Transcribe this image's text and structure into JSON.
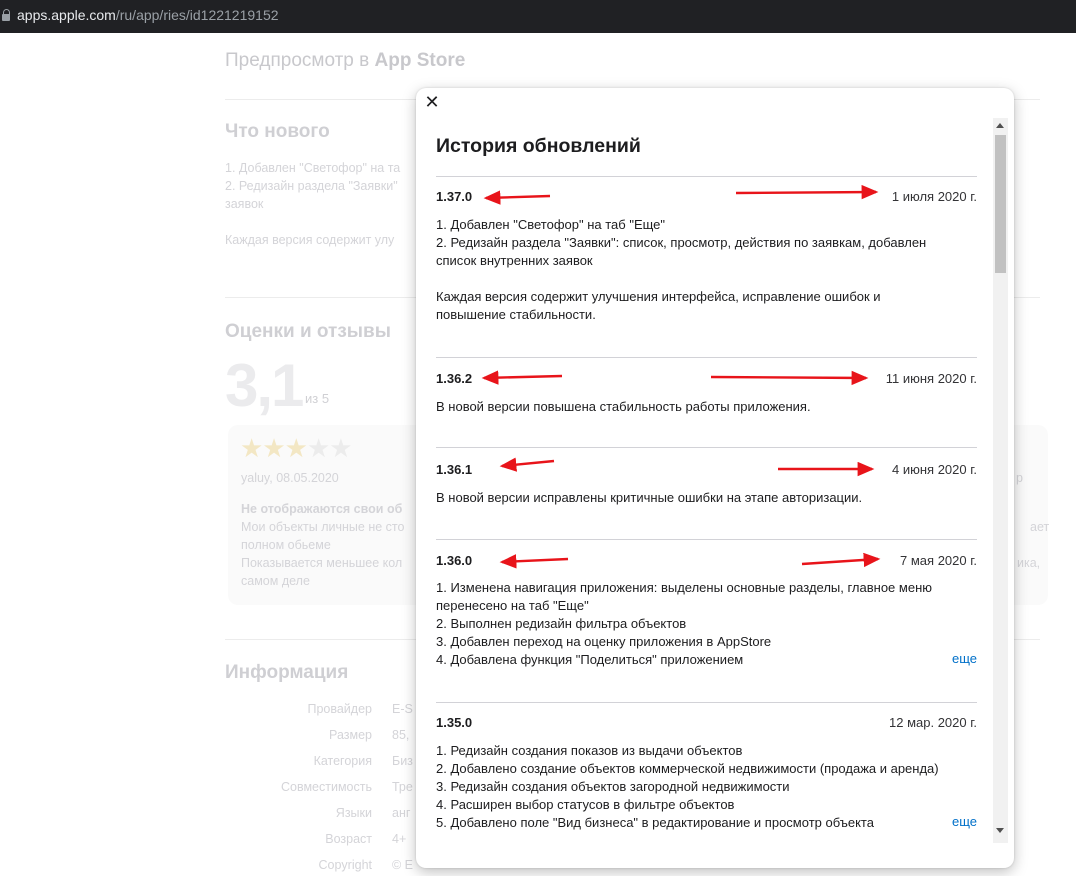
{
  "browser": {
    "url_host": "apps.apple.com",
    "url_path": "/ru/app/ries/id1221219152"
  },
  "background": {
    "preview_prefix": "Предпросмотр в ",
    "preview_store": "App Store",
    "whats_new_title": "Что нового",
    "whats_new_lines": [
      "1. Добавлен \"Светофор\" на та",
      "2. Редизайн раздела \"Заявки\"",
      "заявок",
      "Каждая версия содержит улу"
    ],
    "ratings_title": "Оценки и отзывы",
    "rating_value": "3,1",
    "rating_out_of": "из 5",
    "stars": {
      "filled": 3,
      "total": 5
    },
    "review_author": "yaluy, 08.05.2020",
    "review_title": "Не отображаются свои об",
    "review_lines": [
      "Мои объекты личные не сто",
      "полном обьеме",
      "Показывается меньшее кол",
      "самом деле"
    ],
    "review_right_1": "ает",
    "review_right_2": "ика,",
    "review_right_3": "р",
    "info_title": "Информация",
    "info_rows": [
      {
        "label": "Провайдер",
        "value": "E-S"
      },
      {
        "label": "Размер",
        "value": "85,"
      },
      {
        "label": "Категория",
        "value": "Биз"
      },
      {
        "label": "Совместимость",
        "value": "Тре"
      },
      {
        "label": "Языки",
        "value": "анг"
      },
      {
        "label": "Возраст",
        "value": "4+"
      },
      {
        "label": "Copyright",
        "value": "© E"
      }
    ]
  },
  "modal": {
    "close_glyph": "✕",
    "title": "История обновлений",
    "more_label": "еще",
    "entries": [
      {
        "version": "1.37.0",
        "date": "1 июля 2020 г.",
        "lines": [
          "1. Добавлен \"Светофор\" на таб \"Еще\"",
          "2. Редизайн раздела \"Заявки\": список, просмотр, действия по заявкам, добавлен",
          "список внутренних заявок",
          "",
          "Каждая версия содержит улучшения интерфейса, исправление ошибок и",
          "повышение стабильности."
        ]
      },
      {
        "version": "1.36.2",
        "date": "11 июня 2020 г.",
        "lines": [
          "В новой версии повышена стабильность работы приложения."
        ]
      },
      {
        "version": "1.36.1",
        "date": "4 июня 2020 г.",
        "lines": [
          "В новой версии исправлены критичные ошибки на этапе авторизации."
        ]
      },
      {
        "version": "1.36.0",
        "date": "7 мая 2020 г.",
        "lines": [
          "1. Изменена навигация приложения: выделены основные разделы, главное меню",
          "перенесено на таб \"Еще\"",
          "2. Выполнен редизайн фильтра объектов",
          "3. Добавлен переход на оценку приложения в AppStore",
          "4. Добавлена функция \"Поделиться\" приложением"
        ]
      },
      {
        "version": "1.35.0",
        "date": "12 мар. 2020 г.",
        "lines": [
          "1. Редизайн создания показов из выдачи объектов",
          "2. Добавлено создание объектов коммерческой недвижимости (продажа и аренда)",
          "3. Редизайн создания объектов загородной недвижимости",
          "4. Расширен выбор статусов в фильтре объектов",
          "5. Добавлено поле \"Вид бизнеса\" в редактирование и просмотр объекта"
        ]
      }
    ]
  },
  "colors": {
    "annotation_arrow": "#e8141a",
    "link": "#0070c9"
  }
}
